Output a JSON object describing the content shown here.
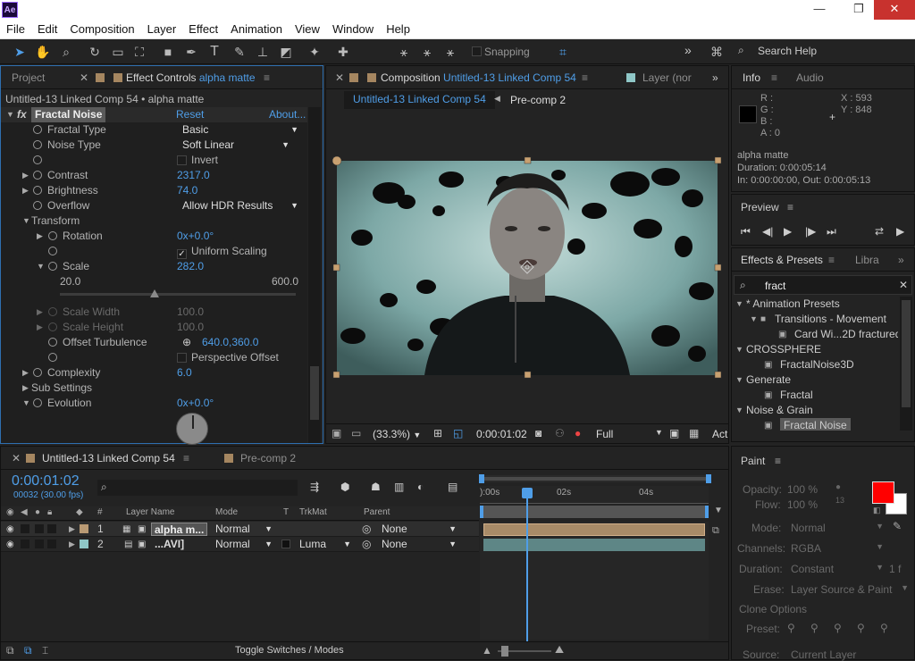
{
  "app": {
    "logo": "Ae",
    "minimize": "—",
    "restore": "❐",
    "close": "✕"
  },
  "menu": [
    "File",
    "Edit",
    "Composition",
    "Layer",
    "Effect",
    "Animation",
    "View",
    "Window",
    "Help"
  ],
  "toolbar": {
    "snapping": "Snapping",
    "search_help": "Search Help",
    "more": "»"
  },
  "effect_panel": {
    "tab_project": "Project",
    "tab_effect_controls": "Effect Controls",
    "tab_layer_name": "alpha matte",
    "header": "Untitled-13 Linked Comp 54 • alpha matte",
    "effect_name": "Fractal Noise",
    "reset": "Reset",
    "about": "About...",
    "fractal_type_label": "Fractal Type",
    "fractal_type_value": "Basic",
    "noise_type_label": "Noise Type",
    "noise_type_value": "Soft Linear",
    "invert_label": "Invert",
    "contrast_label": "Contrast",
    "contrast_value": "2317.0",
    "brightness_label": "Brightness",
    "brightness_value": "74.0",
    "overflow_label": "Overflow",
    "overflow_value": "Allow HDR Results",
    "transform_label": "Transform",
    "rotation_label": "Rotation",
    "rotation_value": "0x+0.0°",
    "uniform_scaling_label": "Uniform Scaling",
    "scale_label": "Scale",
    "scale_value": "282.0",
    "scale_min": "20.0",
    "scale_max": "600.0",
    "scale_fraction": 0.4,
    "scale_width_label": "Scale Width",
    "scale_width_value": "100.0",
    "scale_height_label": "Scale Height",
    "scale_height_value": "100.0",
    "offset_label": "Offset Turbulence",
    "offset_value": "640.0,360.0",
    "perspective_label": "Perspective Offset",
    "complexity_label": "Complexity",
    "complexity_value": "6.0",
    "sub_settings_label": "Sub Settings",
    "evolution_label": "Evolution",
    "evolution_value": "0x+0.0°"
  },
  "comp_panel": {
    "tab_composition": "Composition",
    "comp_name": "Untitled-13 Linked Comp 54",
    "tab_layer": "Layer (nor",
    "crumb_1": "Untitled-13 Linked Comp 54",
    "crumb_2": "Pre-comp 2",
    "zoom": "(33.3%)",
    "timecode": "0:00:01:02",
    "resolution": "Full",
    "act": "Act"
  },
  "info_panel": {
    "tab_info": "Info",
    "tab_audio": "Audio",
    "r": "R :",
    "g": "G :",
    "b": "B :",
    "a": "A : 0",
    "x": "X : 593",
    "y": "Y : 848",
    "layer": "alpha matte",
    "duration": "Duration: 0:00:05:14",
    "in_out": "In: 0:00:00:00, Out: 0:00:05:13"
  },
  "preview_panel": {
    "title": "Preview"
  },
  "effects_presets": {
    "title": "Effects & Presets",
    "tab_libra": "Libra",
    "search_value": "fract",
    "tree": [
      {
        "label": "* Animation Presets",
        "level": 0,
        "kind": "folder"
      },
      {
        "label": "Transitions - Movement",
        "level": 1,
        "kind": "folder"
      },
      {
        "label": "Card Wi...2D fractured",
        "level": 2,
        "kind": "preset"
      },
      {
        "label": "CROSSPHERE",
        "level": 0,
        "kind": "folder"
      },
      {
        "label": "FractalNoise3D",
        "level": 1,
        "kind": "effect"
      },
      {
        "label": "Generate",
        "level": 0,
        "kind": "folder"
      },
      {
        "label": "Fractal",
        "level": 1,
        "kind": "effect"
      },
      {
        "label": "Noise & Grain",
        "level": 0,
        "kind": "folder"
      },
      {
        "label": "Fractal Noise",
        "level": 1,
        "kind": "effect",
        "selected": true
      }
    ]
  },
  "timeline": {
    "tab_comp": "Untitled-13 Linked Comp 54",
    "tab_precomp": "Pre-comp 2",
    "timecode": "0:00:01:02",
    "frames": "00032 (30.00 fps)",
    "col_num": "#",
    "col_layer": "Layer Name",
    "col_mode": "Mode",
    "col_t": "T",
    "col_trkmat": "TrkMat",
    "col_parent": "Parent",
    "ruler": [
      "):00s",
      "02s",
      "04s"
    ],
    "layers": [
      {
        "num": "1",
        "name": "alpha m...",
        "mode": "Normal",
        "trkmat": "",
        "parent": "None",
        "color": "#b99a74"
      },
      {
        "num": "2",
        "name": "...AVI]",
        "mode": "Normal",
        "trkmat": "Luma",
        "parent": "None",
        "color": "#8fc7c7"
      }
    ],
    "toggle": "Toggle Switches / Modes"
  },
  "paint": {
    "title": "Paint",
    "opacity_label": "Opacity:",
    "opacity_value": "100 %",
    "flow_label": "Flow:",
    "flow_value": "100 %",
    "brush_size": "13",
    "mode_label": "Mode:",
    "mode_value": "Normal",
    "channels_label": "Channels:",
    "channels_value": "RGBA",
    "duration_label": "Duration:",
    "duration_value": "Constant",
    "duration_frames": "1 f",
    "erase_label": "Erase:",
    "erase_value": "Layer Source & Paint",
    "clone_label": "Clone Options",
    "preset_label": "Preset:",
    "source_label": "Source:",
    "source_value": "Current Layer",
    "fg_color": "#ff0000",
    "bg_color": "#ffffff"
  }
}
